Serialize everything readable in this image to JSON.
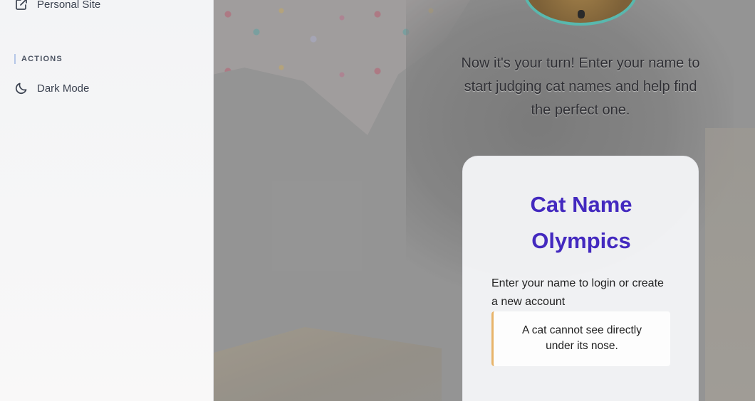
{
  "sidebar": {
    "personal_site": {
      "label": "Personal Site",
      "icon": "external-link-icon"
    },
    "actions_section": "ACTIONS",
    "dark_mode": {
      "label": "Dark Mode",
      "icon": "moon-icon"
    }
  },
  "main": {
    "intro_text": "Now it's your turn! Enter your name to start judging cat names and help find the perfect one.",
    "card": {
      "title": "Cat Name Olympics",
      "description": "Enter your name to login or create a new account",
      "fact": "A cat cannot see directly under its nose."
    }
  },
  "colors": {
    "accent_title": "#4329bf",
    "fact_border": "#e8b469",
    "avatar_ring": "#59b8ae"
  }
}
